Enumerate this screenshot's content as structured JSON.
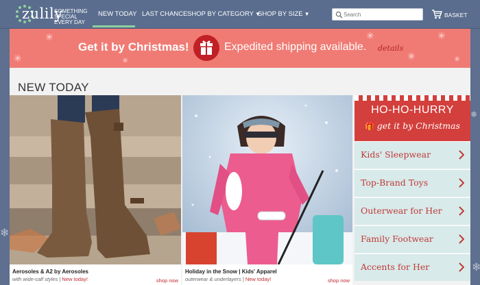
{
  "header": {
    "logo_word": "zulily",
    "logo_tagline_1": "SOMETHING",
    "logo_tagline_2": "SPECIAL",
    "logo_tagline_3": "EVERY DAY",
    "nav": [
      {
        "label": "NEW TODAY"
      },
      {
        "label": "LAST CHANCE"
      },
      {
        "label": "SHOP BY CATEGORY"
      },
      {
        "label": "SHOP BY SIZE"
      }
    ],
    "search_placeholder": "Search",
    "basket_label": "BASKET"
  },
  "banner": {
    "title": "Get it by Christmas!",
    "subtitle": "Expedited shipping available.",
    "details": "details"
  },
  "main": {
    "section_title": "NEW TODAY",
    "events": [
      {
        "title": "Aerosoles & A2 by Aerosoles",
        "sub": "with wide-calf styles",
        "badge": "New today!",
        "cta": "shop now"
      },
      {
        "title": "Holiday in the Snow | Kids' Apparel",
        "sub": "outerwear & underlayers",
        "badge": "New today!",
        "cta": "shop now"
      }
    ],
    "promo": {
      "title": "HO-HO-HURRY",
      "sub": "get it by Christmas"
    },
    "categories": [
      {
        "label": "Kids' Sleepwear"
      },
      {
        "label": "Top-Brand Toys"
      },
      {
        "label": "Outerwear for Her"
      },
      {
        "label": "Family Footwear"
      },
      {
        "label": "Accents for Her"
      }
    ]
  },
  "colors": {
    "header_bg": "#5a6d8e",
    "banner_bg": "#f07b74",
    "accent_red": "#c0282e",
    "category_bg": "#d8eaea"
  }
}
